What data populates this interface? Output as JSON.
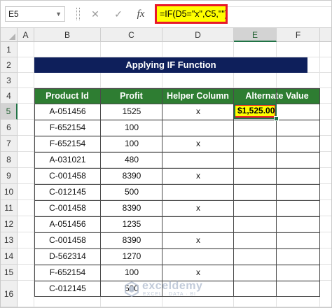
{
  "formula_bar": {
    "name_box": "E5",
    "cancel_icon": "close-icon",
    "enter_icon": "checkmark-icon",
    "fx_label": "fx",
    "formula": "=IF(D5=\"x\",C5,\"\")"
  },
  "columns": [
    "A",
    "B",
    "C",
    "D",
    "E",
    "F"
  ],
  "rows": [
    "1",
    "2",
    "3",
    "4",
    "5",
    "6",
    "7",
    "8",
    "9",
    "10",
    "11",
    "12",
    "13",
    "14",
    "15",
    "16"
  ],
  "title": "Applying IF Function",
  "table": {
    "headers": [
      "Product Id",
      "Profit",
      "Helper Column",
      "Alternate Value"
    ],
    "rows": [
      {
        "id": "A-051456",
        "profit": "1525",
        "helper": "x",
        "alt": "$1,525.00"
      },
      {
        "id": "F-652154",
        "profit": "100",
        "helper": "",
        "alt": ""
      },
      {
        "id": "F-652154",
        "profit": "100",
        "helper": "x",
        "alt": ""
      },
      {
        "id": "A-031021",
        "profit": "480",
        "helper": "",
        "alt": ""
      },
      {
        "id": "C-001458",
        "profit": "8390",
        "helper": "x",
        "alt": ""
      },
      {
        "id": "C-012145",
        "profit": "500",
        "helper": "",
        "alt": ""
      },
      {
        "id": "C-001458",
        "profit": "8390",
        "helper": "x",
        "alt": ""
      },
      {
        "id": "A-051456",
        "profit": "1235",
        "helper": "",
        "alt": ""
      },
      {
        "id": "C-001458",
        "profit": "8390",
        "helper": "x",
        "alt": ""
      },
      {
        "id": "D-562314",
        "profit": "1270",
        "helper": "",
        "alt": ""
      },
      {
        "id": "F-652154",
        "profit": "100",
        "helper": "x",
        "alt": ""
      },
      {
        "id": "C-012145",
        "profit": "500",
        "helper": "",
        "alt": ""
      }
    ]
  },
  "selected_cell": "E5",
  "watermark": {
    "name": "exceldemy",
    "tagline": "EXCEL · DATA · BI"
  },
  "colors": {
    "title_bg": "#0e1f5b",
    "header_bg": "#2e7d32",
    "highlight": "#ffff00",
    "highlight_border": "#e8182a"
  }
}
